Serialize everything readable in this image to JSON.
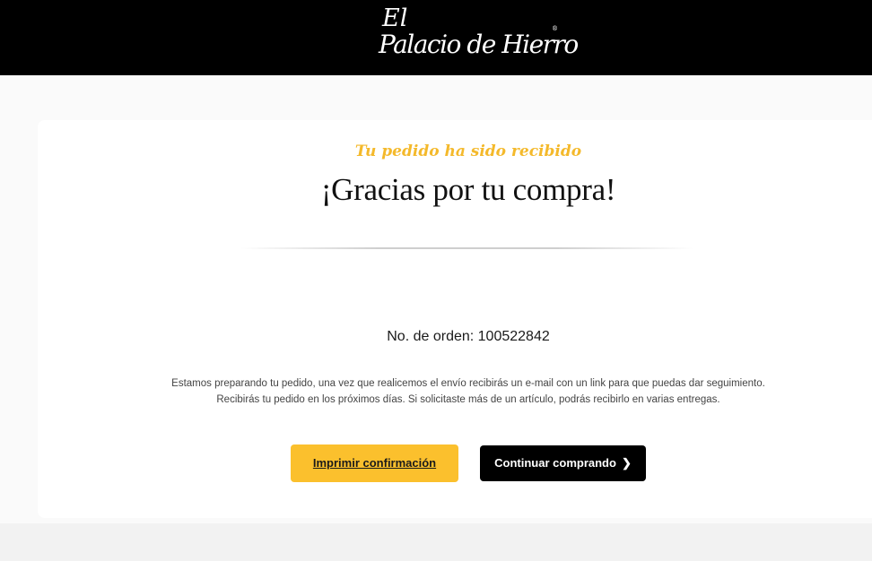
{
  "header": {
    "logo_line1": "El",
    "logo_line2": "Palacio de Hierro",
    "logo_reg": "®"
  },
  "confirmation": {
    "subtitle": "Tu pedido ha sido recibido",
    "title": "¡Gracias por tu compra!",
    "order_label": "No. de orden: 100522842",
    "message_line1": "Estamos preparando tu pedido, una vez que realicemos el envío recibirás un e-mail con un link para que puedas dar seguimiento.",
    "message_line2": "Recibirás tu pedido en los próximos días. Si solicitaste más de un artículo, podrás recibirlo en varias entregas."
  },
  "actions": {
    "print_label": "Imprimir confirmación",
    "continue_label": "Continuar comprando",
    "continue_icon": "chevron-right-icon"
  },
  "colors": {
    "header_bg": "#000000",
    "accent_yellow": "#fbc02d",
    "subtitle_gold": "#f4b92b"
  }
}
